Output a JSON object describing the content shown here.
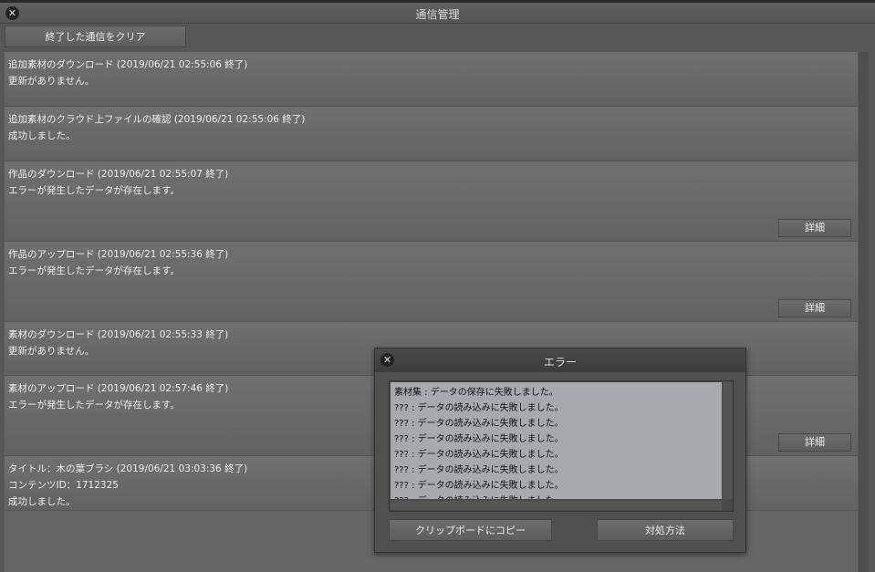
{
  "window": {
    "title": "通信管理",
    "clear_label": "終了した通信をクリア"
  },
  "rows": [
    {
      "title": "追加素材のダウンロード (2019/06/21 02:55:06 終了)",
      "lines": [
        "更新がありません。"
      ]
    },
    {
      "title": "追加素材のクラウド上ファイルの確認 (2019/06/21 02:55:06 終了)",
      "lines": [
        "成功しました。"
      ]
    },
    {
      "title": "作品のダウンロード (2019/06/21 02:55:07 終了)",
      "lines": [
        "エラーが発生したデータが存在します。"
      ],
      "detail": "詳細"
    },
    {
      "title": "作品のアップロード (2019/06/21 02:55:36 終了)",
      "lines": [
        "エラーが発生したデータが存在します。"
      ],
      "detail": "詳細"
    },
    {
      "title": "素材のダウンロード (2019/06/21 02:55:33 終了)",
      "lines": [
        "更新がありません。"
      ]
    },
    {
      "title": "素材のアップロード (2019/06/21 02:57:46 終了)",
      "lines": [
        "エラーが発生したデータが存在します。"
      ],
      "detail": "詳細"
    },
    {
      "title": "タイトル：木の葉ブラシ (2019/06/21 03:03:36 終了)",
      "lines": [
        "コンテンツID：1712325",
        "成功しました。"
      ]
    }
  ],
  "dialog": {
    "title": "エラー",
    "messages": [
      "素材集 : データの保存に失敗しました。",
      "??? : データの読み込みに失敗しました。",
      "??? : データの読み込みに失敗しました。",
      "??? : データの読み込みに失敗しました。",
      "??? : データの読み込みに失敗しました。",
      "??? : データの読み込みに失敗しました。",
      "??? : データの読み込みに失敗しました。",
      "??? : データの読み込みに失敗しました。"
    ],
    "copy_label": "クリップボードにコピー",
    "solution_label": "対処方法"
  }
}
